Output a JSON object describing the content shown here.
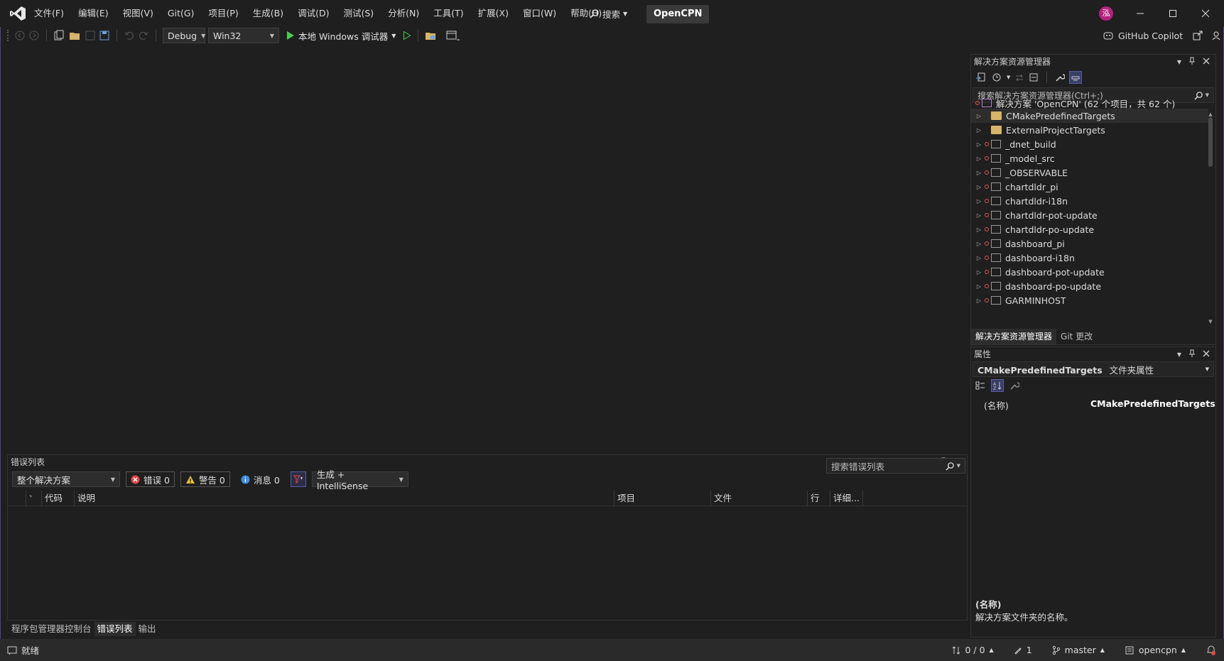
{
  "menu": {
    "items": [
      "文件(F)",
      "编辑(E)",
      "视图(V)",
      "Git(G)",
      "项目(P)",
      "生成(B)",
      "调试(D)",
      "测试(S)",
      "分析(N)",
      "工具(T)",
      "扩展(X)",
      "窗口(W)",
      "帮助(H)"
    ],
    "search_label": "搜索",
    "solution_name": "OpenCPN",
    "avatar_text": "泓"
  },
  "toolbar": {
    "config": "Debug",
    "platform": "Win32",
    "run_label": "本地 Windows 调试器",
    "copilot_label": "GitHub Copilot"
  },
  "solution_explorer": {
    "title": "解决方案资源管理器",
    "search_placeholder": "搜索解决方案资源管理器(Ctrl+;)",
    "root": "解决方案 'OpenCPN' (62 个项目，共 62 个)",
    "items": [
      {
        "label": "CMakePredefinedTargets",
        "kind": "folder"
      },
      {
        "label": "ExternalProjectTargets",
        "kind": "folder"
      },
      {
        "label": "_dnet_build",
        "kind": "project"
      },
      {
        "label": "_model_src",
        "kind": "project"
      },
      {
        "label": "_OBSERVABLE",
        "kind": "project"
      },
      {
        "label": "chartdldr_pi",
        "kind": "project"
      },
      {
        "label": "chartdldr-i18n",
        "kind": "project"
      },
      {
        "label": "chartdldr-pot-update",
        "kind": "project"
      },
      {
        "label": "chartdldr-po-update",
        "kind": "project"
      },
      {
        "label": "dashboard_pi",
        "kind": "project"
      },
      {
        "label": "dashboard-i18n",
        "kind": "project"
      },
      {
        "label": "dashboard-pot-update",
        "kind": "project"
      },
      {
        "label": "dashboard-po-update",
        "kind": "project"
      },
      {
        "label": "GARMINHOST",
        "kind": "project"
      }
    ],
    "tabs": [
      "解决方案资源管理器",
      "Git 更改"
    ]
  },
  "properties": {
    "title": "属性",
    "object_name": "CMakePredefinedTargets",
    "object_type": "文件夹属性",
    "rows": [
      {
        "name": "(名称)",
        "value": "CMakePredefinedTargets"
      }
    ],
    "desc_title": "(名称)",
    "desc_text": "解决方案文件夹的名称。"
  },
  "error_list": {
    "title": "错误列表",
    "scope": "整个解决方案",
    "errors": "错误 0",
    "warnings": "警告 0",
    "messages": "消息 0",
    "source": "生成 + IntelliSense",
    "search_placeholder": "搜索错误列表",
    "columns": [
      "代码",
      "说明",
      "项目",
      "文件",
      "行",
      "详细..."
    ]
  },
  "bottom_tabs": [
    "程序包管理器控制台",
    "错误列表",
    "输出"
  ],
  "status": {
    "ready": "就绪",
    "changes": "0 / 0",
    "edits": "1",
    "branch": "master",
    "repo": "opencpn"
  }
}
